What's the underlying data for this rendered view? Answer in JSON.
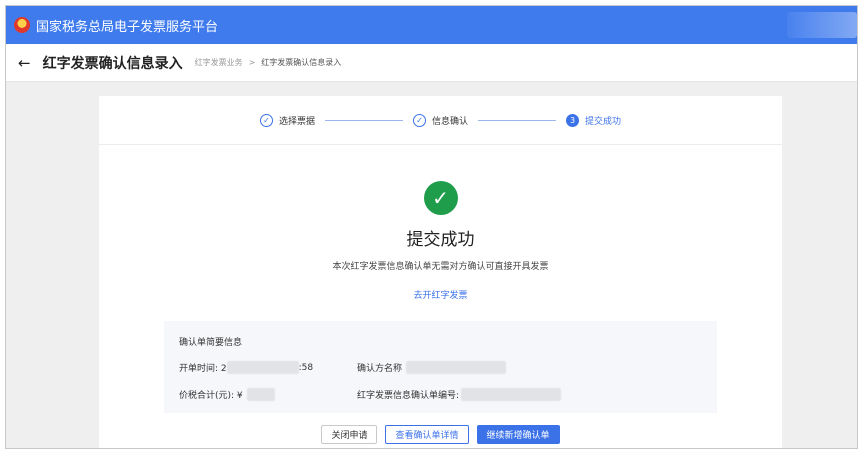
{
  "header": {
    "title": "国家税务总局电子发票服务平台",
    "logo": "tax-emblem-icon"
  },
  "subheader": {
    "back_icon": "←",
    "page_title": "红字发票确认信息录入",
    "breadcrumb": [
      "红字发票业务",
      ">",
      "红字发票确认信息录入"
    ]
  },
  "steps": [
    {
      "index": "✓",
      "label": "选择票据",
      "state": "done"
    },
    {
      "index": "✓",
      "label": "信息确认",
      "state": "done"
    },
    {
      "index": "3",
      "label": "提交成功",
      "state": "active"
    }
  ],
  "result": {
    "icon": "check-icon",
    "title": "提交成功",
    "description": "本次红字发票信息确认单无需对方确认可直接开具发票",
    "link": "去开红字发票"
  },
  "summary": {
    "title": "确认单简要信息",
    "issue_time_label": "开单时间: 2",
    "issue_time_tail": ":58",
    "buyer_label": "确认方名称",
    "amount_label": "价税合计(元): ¥",
    "amount_tail": "",
    "confirm_no_label": "红字发票信息确认单编号:"
  },
  "actions": {
    "close": "关闭申请",
    "view_details": "查看确认单详情",
    "continue": "继续新增确认单"
  },
  "colors": {
    "primary": "#3b72e8",
    "header": "#3f7bed",
    "success": "#1f9d4b"
  }
}
